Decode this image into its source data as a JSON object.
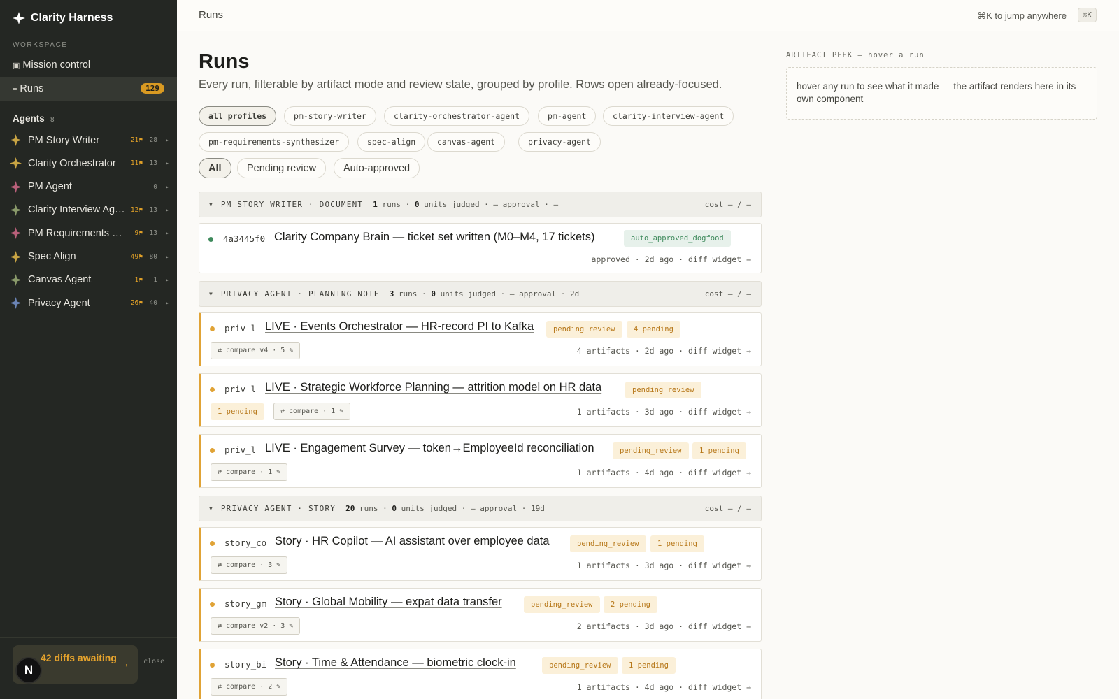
{
  "sidebar": {
    "brand": "Clarity Harness",
    "workspace_label": "WORKSPACE",
    "mission_control": "Mission control",
    "mission_icon": "▣",
    "runs_label": "Runs",
    "runs_icon": "≡",
    "runs_count": "129",
    "agents_label": "Agents",
    "agents_count": "8",
    "agents": [
      {
        "name": "PM Story Writer",
        "flags": "21⚑",
        "total": "28",
        "color": "#c9a544"
      },
      {
        "name": "Clarity Orchestrator",
        "flags": "11⚑",
        "total": "13",
        "color": "#c9a544"
      },
      {
        "name": "PM Agent",
        "flags": "",
        "total": "0",
        "color": "#b9607a"
      },
      {
        "name": "Clarity Interview Agent",
        "flags": "12⚑",
        "total": "13",
        "color": "#8a9a6a"
      },
      {
        "name": "PM Requirements Synthesizer",
        "flags": "9⚑",
        "total": "13",
        "color": "#b9607a"
      },
      {
        "name": "Spec Align",
        "flags": "49⚑",
        "total": "80",
        "color": "#c9a544"
      },
      {
        "name": "Canvas Agent",
        "flags": "1⚑",
        "total": "1",
        "color": "#8a9a6a"
      },
      {
        "name": "Privacy Agent",
        "flags": "26⚑",
        "total": "40",
        "color": "#6b84b5"
      }
    ],
    "diffs_text": "42 diffs awaiting",
    "diffs_arrow": "→",
    "close_label": "close",
    "avatar_letter": "N"
  },
  "header": {
    "crumb": "Runs",
    "jump_text": "⌘K to jump anywhere",
    "kbd": "⌘K"
  },
  "main": {
    "title": "Runs",
    "subtitle": "Every run, filterable by artifact mode and review state, grouped by profile. Rows open already-focused.",
    "profile_filters": [
      "all profiles",
      "pm-story-writer",
      "clarity-orchestrator-agent",
      "pm-agent",
      "clarity-interview-agent",
      "pm-requirements-synthesizer",
      "spec-align",
      "canvas-agent",
      "privacy-agent"
    ],
    "state_filters": [
      "All",
      "Pending review",
      "Auto-approved"
    ],
    "groups": [
      {
        "name": "PM STORY WRITER · DOCUMENT",
        "runs": "1",
        "runs_label": "runs ·",
        "units": "0",
        "rest": "units judged · — approval · —",
        "cost": "cost — / —"
      },
      {
        "name": "PRIVACY AGENT · PLANNING_NOTE",
        "runs": "3",
        "runs_label": "runs ·",
        "units": "0",
        "rest": "units judged · — approval · 2d",
        "cost": "cost — / —"
      },
      {
        "name": "PRIVACY AGENT · STORY",
        "runs": "20",
        "runs_label": "runs ·",
        "units": "0",
        "rest": "units judged · — approval · 19d",
        "cost": "cost — / —"
      }
    ],
    "runs": [
      {
        "id": "4a3445f0",
        "title": "Clarity Company Brain — ticket set written (M0–M4, 17 tickets)",
        "status": "auto_approved_dogfood",
        "pending": "",
        "compare": "",
        "meta": "approved · 2d ago · ",
        "diff": "diff widget →"
      },
      {
        "id": "priv_l",
        "title": "LIVE · Events Orchestrator — HR-record PI to Kafka",
        "status": "pending_review",
        "pending": "4 pending",
        "compare": "⇄ compare v4 · 5 ✎",
        "meta": "4 artifacts · 2d ago · ",
        "diff": "diff widget →"
      },
      {
        "id": "priv_l",
        "title": "LIVE · Strategic Workforce Planning — attrition model on HR data",
        "status": "pending_review",
        "pending": "1 pending",
        "compare": "⇄ compare · 1 ✎",
        "meta": "1 artifacts · 3d ago · ",
        "diff": "diff widget →"
      },
      {
        "id": "priv_l",
        "title": "LIVE · Engagement Survey — token→EmployeeId reconciliation",
        "status": "pending_review",
        "pending": "1 pending",
        "compare": "⇄ compare · 1 ✎",
        "meta": "1 artifacts · 4d ago · ",
        "diff": "diff widget →"
      },
      {
        "id": "story_co",
        "title": "Story · HR Copilot — AI assistant over employee data",
        "status": "pending_review",
        "pending": "1 pending",
        "compare": "⇄ compare · 3 ✎",
        "meta": "1 artifacts · 3d ago · ",
        "diff": "diff widget →"
      },
      {
        "id": "story_gm",
        "title": "Story · Global Mobility — expat data transfer",
        "status": "pending_review",
        "pending": "2 pending",
        "compare": "⇄ compare v2 · 3 ✎",
        "meta": "2 artifacts · 3d ago · ",
        "diff": "diff widget →"
      },
      {
        "id": "story_bi",
        "title": "Story · Time & Attendance — biometric clock-in",
        "status": "pending_review",
        "pending": "1 pending",
        "compare": "⇄ compare · 2 ✎",
        "meta": "1 artifacts · 4d ago · ",
        "diff": "diff widget →"
      }
    ]
  },
  "peek": {
    "label": "ARTIFACT PEEK — hover a run",
    "text": "hover any run to see what it made — the artifact renders here in its own component"
  },
  "colors": {
    "accent": "#d99a22",
    "pending": "#e0a336",
    "approved": "#3e8a5c",
    "sidebar": "#242723"
  }
}
